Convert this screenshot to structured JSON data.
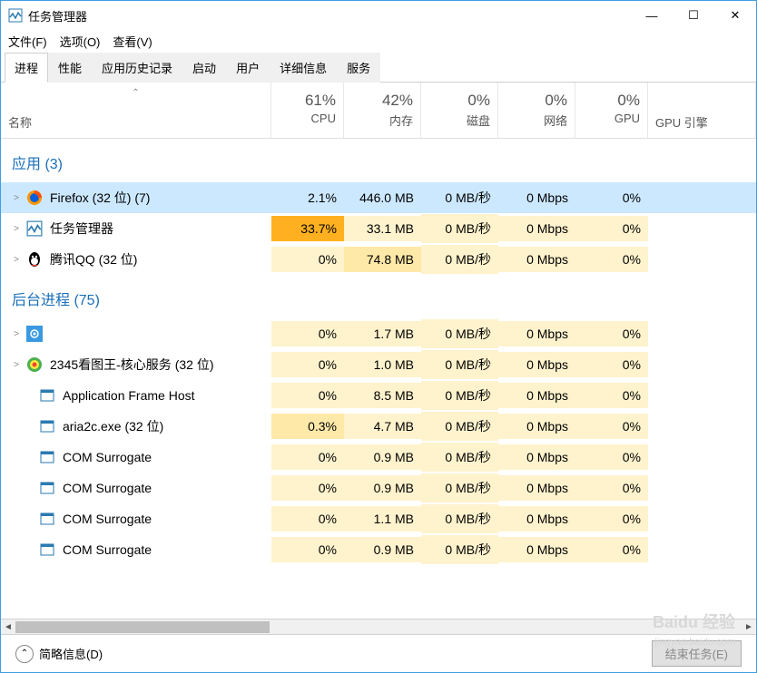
{
  "window": {
    "title": "任务管理器"
  },
  "win_controls": {
    "min": "—",
    "max": "☐",
    "close": "✕"
  },
  "menubar": [
    {
      "label": "文件(F)"
    },
    {
      "label": "选项(O)"
    },
    {
      "label": "查看(V)"
    }
  ],
  "tabs": [
    {
      "label": "进程",
      "active": true
    },
    {
      "label": "性能"
    },
    {
      "label": "应用历史记录"
    },
    {
      "label": "启动"
    },
    {
      "label": "用户"
    },
    {
      "label": "详细信息"
    },
    {
      "label": "服务"
    }
  ],
  "columns": {
    "name": "名称",
    "cpu": {
      "pct": "61%",
      "label": "CPU"
    },
    "mem": {
      "pct": "42%",
      "label": "内存"
    },
    "disk": {
      "pct": "0%",
      "label": "磁盘"
    },
    "net": {
      "pct": "0%",
      "label": "网络"
    },
    "gpu": {
      "pct": "0%",
      "label": "GPU"
    },
    "gpueng": "GPU 引擎"
  },
  "groups": [
    {
      "title": "应用 (3)",
      "rows": [
        {
          "expand": true,
          "icon": "firefox",
          "name": "Firefox (32 位) (7)",
          "cpu": "2.1%",
          "mem": "446.0 MB",
          "disk": "0 MB/秒",
          "net": "0 Mbps",
          "gpu": "0%",
          "selected": true,
          "heat": {
            "cpu": 1,
            "mem": 1
          }
        },
        {
          "expand": true,
          "icon": "taskmgr",
          "name": "任务管理器",
          "cpu": "33.7%",
          "mem": "33.1 MB",
          "disk": "0 MB/秒",
          "net": "0 Mbps",
          "gpu": "0%",
          "heat": {
            "cpu": 4,
            "mem": 0
          }
        },
        {
          "expand": true,
          "icon": "qq",
          "name": "腾讯QQ (32 位)",
          "cpu": "0%",
          "mem": "74.8 MB",
          "disk": "0 MB/秒",
          "net": "0 Mbps",
          "gpu": "0%",
          "heat": {
            "cpu": 0,
            "mem": 1
          }
        }
      ]
    },
    {
      "title": "后台进程 (75)",
      "rows": [
        {
          "expand": true,
          "icon": "gear",
          "name": "",
          "cpu": "0%",
          "mem": "1.7 MB",
          "disk": "0 MB/秒",
          "net": "0 Mbps",
          "gpu": "0%",
          "heat": {
            "cpu": 0,
            "mem": 0
          }
        },
        {
          "expand": true,
          "icon": "2345",
          "name": "2345看图王-核心服务 (32 位)",
          "cpu": "0%",
          "mem": "1.0 MB",
          "disk": "0 MB/秒",
          "net": "0 Mbps",
          "gpu": "0%",
          "heat": {
            "cpu": 0,
            "mem": 0
          }
        },
        {
          "expand": false,
          "icon": "app",
          "name": "Application Frame Host",
          "cpu": "0%",
          "mem": "8.5 MB",
          "disk": "0 MB/秒",
          "net": "0 Mbps",
          "gpu": "0%",
          "heat": {
            "cpu": 0,
            "mem": 0
          }
        },
        {
          "expand": false,
          "icon": "app",
          "name": "aria2c.exe (32 位)",
          "cpu": "0.3%",
          "mem": "4.7 MB",
          "disk": "0 MB/秒",
          "net": "0 Mbps",
          "gpu": "0%",
          "heat": {
            "cpu": 1,
            "mem": 0
          }
        },
        {
          "expand": false,
          "icon": "app",
          "name": "COM Surrogate",
          "cpu": "0%",
          "mem": "0.9 MB",
          "disk": "0 MB/秒",
          "net": "0 Mbps",
          "gpu": "0%",
          "heat": {
            "cpu": 0,
            "mem": 0
          }
        },
        {
          "expand": false,
          "icon": "app",
          "name": "COM Surrogate",
          "cpu": "0%",
          "mem": "0.9 MB",
          "disk": "0 MB/秒",
          "net": "0 Mbps",
          "gpu": "0%",
          "heat": {
            "cpu": 0,
            "mem": 0
          }
        },
        {
          "expand": false,
          "icon": "app",
          "name": "COM Surrogate",
          "cpu": "0%",
          "mem": "1.1 MB",
          "disk": "0 MB/秒",
          "net": "0 Mbps",
          "gpu": "0%",
          "heat": {
            "cpu": 0,
            "mem": 0
          }
        },
        {
          "expand": false,
          "icon": "app",
          "name": "COM Surrogate",
          "cpu": "0%",
          "mem": "0.9 MB",
          "disk": "0 MB/秒",
          "net": "0 Mbps",
          "gpu": "0%",
          "heat": {
            "cpu": 0,
            "mem": 0
          }
        }
      ]
    }
  ],
  "footer": {
    "fewer_details": "简略信息(D)",
    "end_task": "结束任务(E)"
  },
  "watermark": {
    "main": "Baidu 经验",
    "sub": "jingyan.baidu.com"
  }
}
